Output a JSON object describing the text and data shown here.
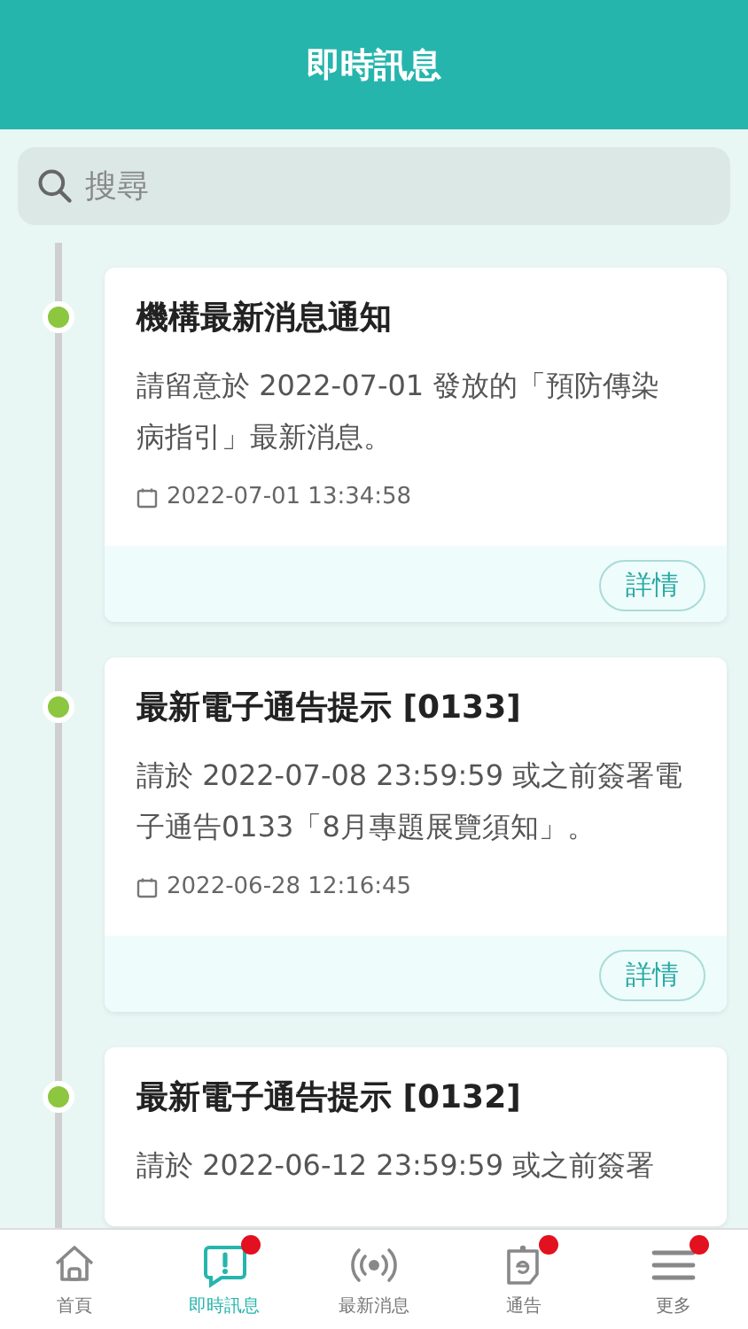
{
  "header": {
    "title": "即時訊息"
  },
  "search": {
    "placeholder": "搜尋"
  },
  "messages": [
    {
      "title": "機構最新消息通知",
      "body": "請留意於 2022-07-01 發放的「預防傳染病指引」最新消息。",
      "time": "2022-07-01 13:34:58",
      "action": "詳情"
    },
    {
      "title": "最新電子通告提示 [0133]",
      "body": "請於 2022-07-08 23:59:59 或之前簽署電子通告0133「8月專題展覽須知」。",
      "time": "2022-06-28 12:16:45",
      "action": "詳情"
    },
    {
      "title": "最新電子通告提示 [0132]",
      "body": "請於 2022-06-12 23:59:59 或之前簽署"
    }
  ],
  "tabs": [
    {
      "kind": "home",
      "label": "首頁",
      "selected": false,
      "badge": false
    },
    {
      "kind": "chat",
      "label": "即時訊息",
      "selected": true,
      "badge": true
    },
    {
      "kind": "broadcast",
      "label": "最新消息",
      "selected": false,
      "badge": false
    },
    {
      "kind": "notice",
      "label": "通告",
      "selected": false,
      "badge": true
    },
    {
      "kind": "menu",
      "label": "更多",
      "selected": false,
      "badge": true
    }
  ]
}
